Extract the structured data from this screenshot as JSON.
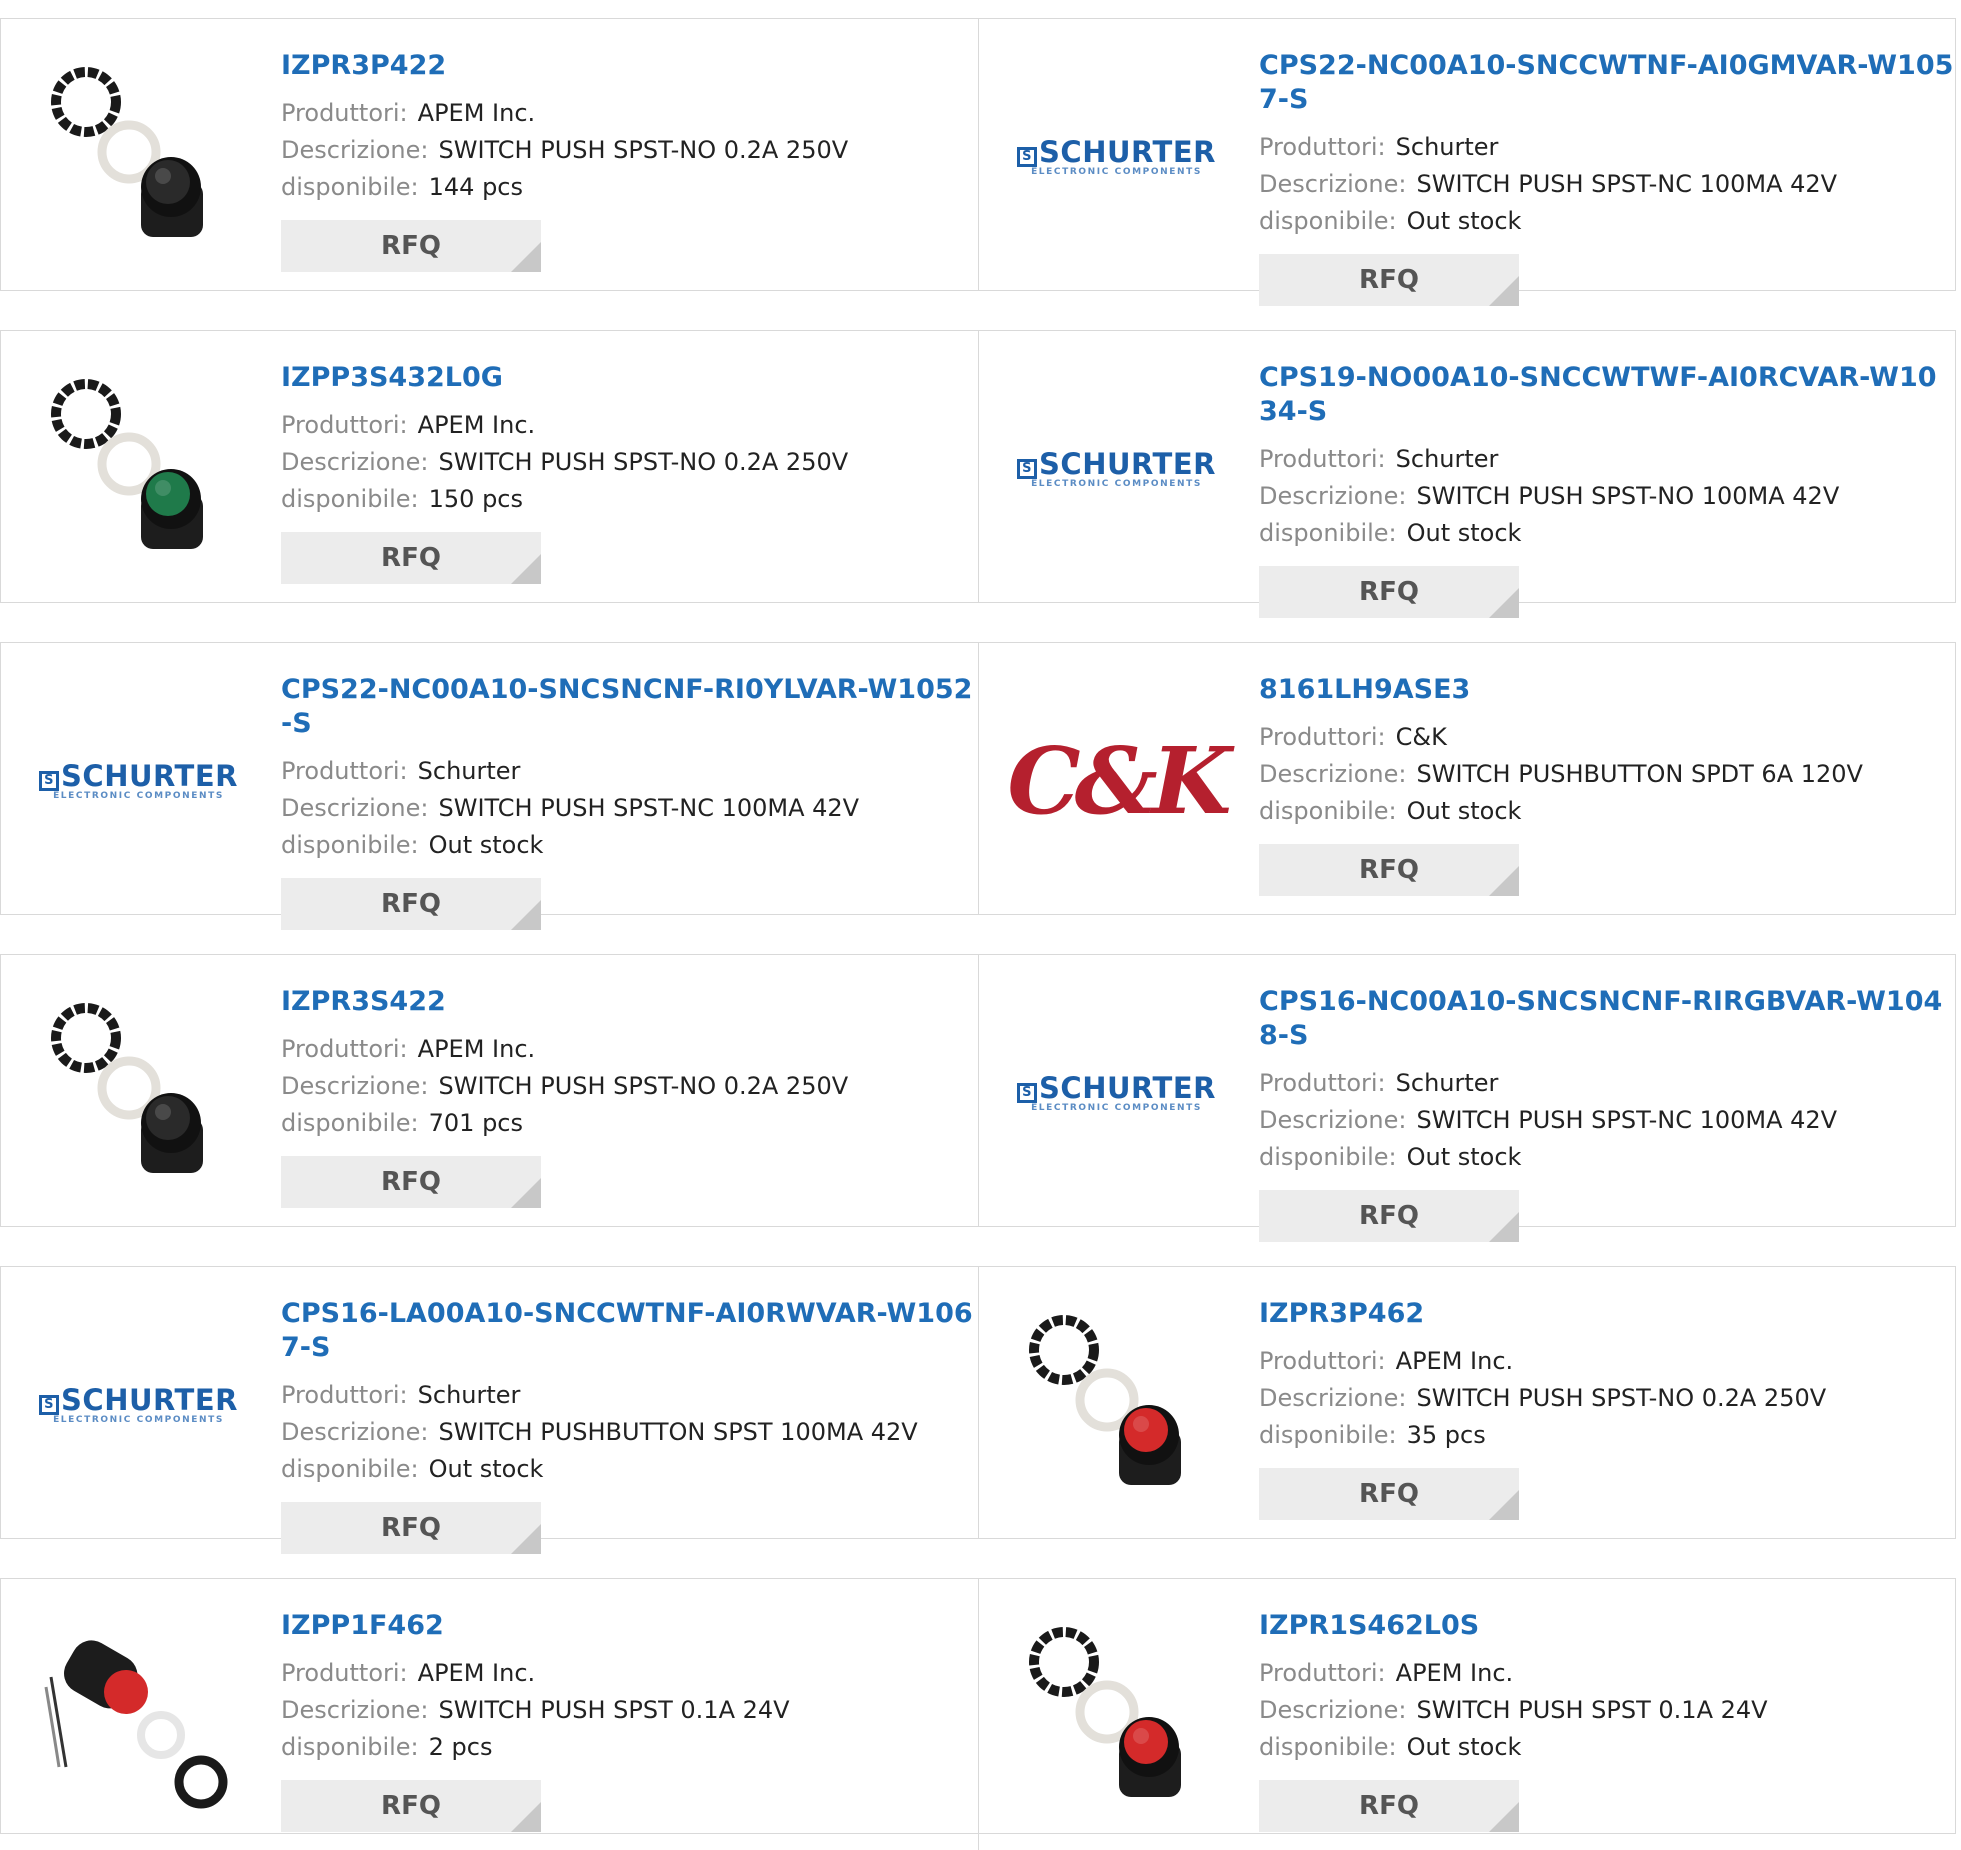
{
  "labels": {
    "manufacturer": "Produttori:",
    "description": "Descrizione:",
    "available": "disponibile:",
    "rfq": "RFQ"
  },
  "brands": {
    "schurter": "SCHURTER",
    "schurter_sub": "ELECTRONIC COMPONENTS",
    "schurter_mark": "S",
    "ck": "C&K"
  },
  "colors": {
    "link": "#1f6db7",
    "label": "#8a8a8a",
    "rfq_bg": "#ececec",
    "schurter": "#1d5fa8",
    "ck": "#b5202e"
  },
  "products": [
    {
      "pn": "IZPR3P422",
      "mfr": "APEM Inc.",
      "desc": "SWITCH PUSH SPST-NO 0.2A 250V",
      "avail": "144 pcs",
      "image": "black-pushbutton-switch"
    },
    {
      "pn": "CPS22-NC00A10-SNCCWTNF-AI0GMVAR-W1057-S",
      "mfr": "Schurter",
      "desc": "SWITCH PUSH SPST-NC 100MA 42V",
      "avail": "Out stock",
      "image": "schurter-logo"
    },
    {
      "pn": "IZPP3S432L0G",
      "mfr": "APEM Inc.",
      "desc": "SWITCH PUSH SPST-NO 0.2A 250V",
      "avail": "150 pcs",
      "image": "green-pushbutton-switch"
    },
    {
      "pn": "CPS19-NO00A10-SNCCWTWF-AI0RCVAR-W1034-S",
      "mfr": "Schurter",
      "desc": "SWITCH PUSH SPST-NO 100MA 42V",
      "avail": "Out stock",
      "image": "schurter-logo"
    },
    {
      "pn": "CPS22-NC00A10-SNCSNCNF-RI0YLVAR-W1052-S",
      "mfr": "Schurter",
      "desc": "SWITCH PUSH SPST-NC 100MA 42V",
      "avail": "Out stock",
      "image": "schurter-logo"
    },
    {
      "pn": "8161LH9ASE3",
      "mfr": "C&K",
      "desc": "SWITCH PUSHBUTTON SPDT 6A 120V",
      "avail": "Out stock",
      "image": "ck-logo"
    },
    {
      "pn": "IZPR3S422",
      "mfr": "APEM Inc.",
      "desc": "SWITCH PUSH SPST-NO 0.2A 250V",
      "avail": "701 pcs",
      "image": "black-pushbutton-switch"
    },
    {
      "pn": "CPS16-NC00A10-SNCSNCNF-RIRGBVAR-W1048-S",
      "mfr": "Schurter",
      "desc": "SWITCH PUSH SPST-NC 100MA 42V",
      "avail": "Out stock",
      "image": "schurter-logo"
    },
    {
      "pn": "CPS16-LA00A10-SNCCWTNF-AI0RWVAR-W1067-S",
      "mfr": "Schurter",
      "desc": "SWITCH PUSHBUTTON SPST 100MA 42V",
      "avail": "Out stock",
      "image": "schurter-logo"
    },
    {
      "pn": "IZPR3P462",
      "mfr": "APEM Inc.",
      "desc": "SWITCH PUSH SPST-NO 0.2A 250V",
      "avail": "35 pcs",
      "image": "red-pushbutton-switch"
    },
    {
      "pn": "IZPP1F462",
      "mfr": "APEM Inc.",
      "desc": "SWITCH PUSH SPST 0.1A 24V",
      "avail": "2 pcs",
      "image": "red-wired-pushbutton-switch"
    },
    {
      "pn": "IZPR1S462L0S",
      "mfr": "APEM Inc.",
      "desc": "SWITCH PUSH SPST 0.1A 24V",
      "avail": "Out stock",
      "image": "red-pushbutton-switch"
    }
  ]
}
